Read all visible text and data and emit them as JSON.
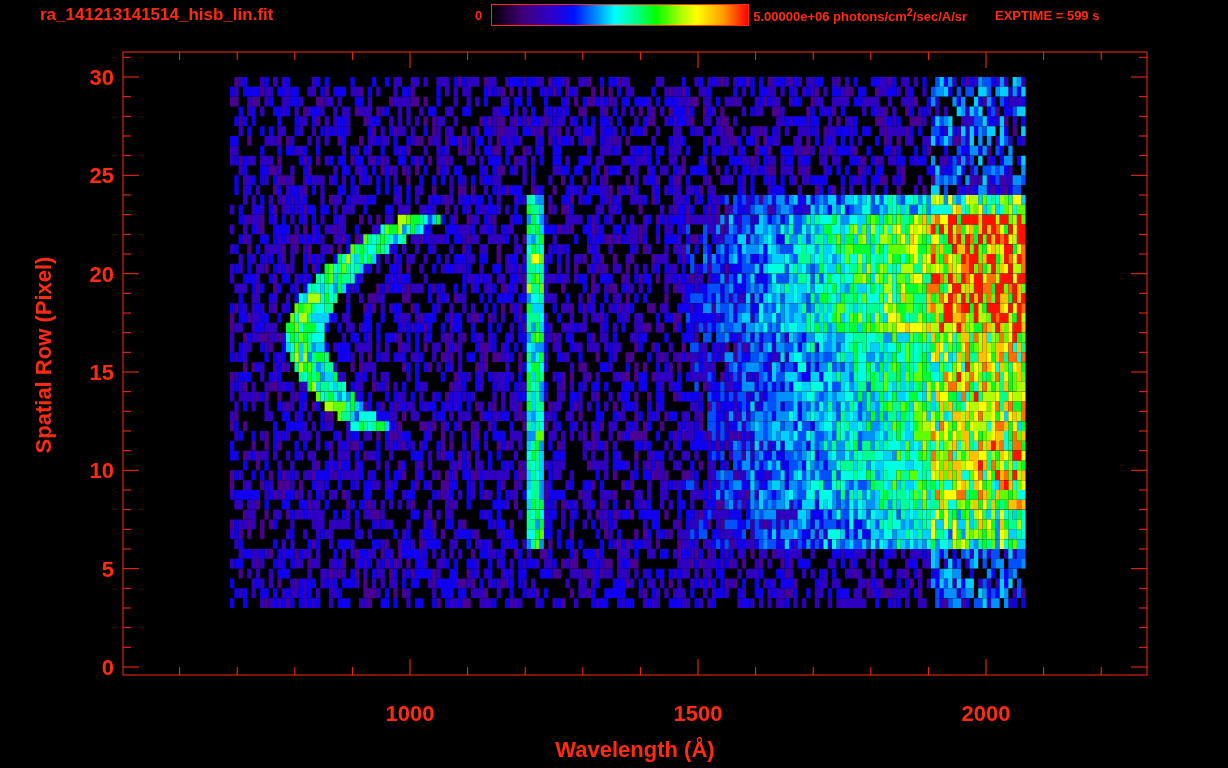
{
  "header": {
    "filename": "ra_141213141514_hisb_lin.fit",
    "colorbar": {
      "min_label": "0",
      "max_label": "5.00000e+06 photons/cm$^{2}$/sec/A/sr"
    },
    "exposure": "EXPTIME = 599 s"
  },
  "plot": {
    "ylabel": "Spatial Row (Pixel)",
    "xlabel": "Wavelength (Å)",
    "yticks": [
      "30",
      "25",
      "20",
      "15",
      "10",
      "5",
      "0"
    ],
    "xticks": [
      "1000",
      "1500",
      "2000"
    ]
  }
}
